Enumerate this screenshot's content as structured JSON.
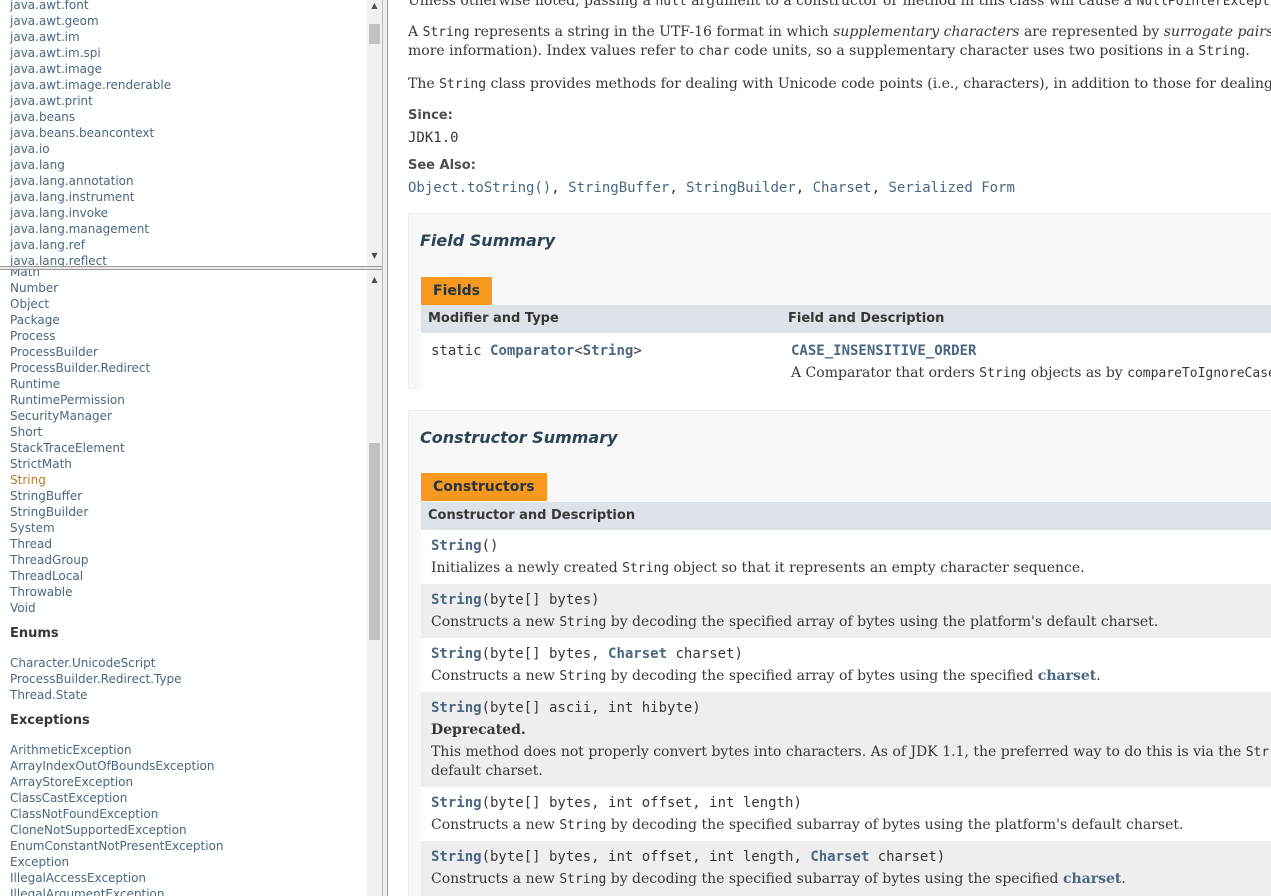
{
  "packages": [
    "java.awt.font",
    "java.awt.geom",
    "java.awt.im",
    "java.awt.im.spi",
    "java.awt.image",
    "java.awt.image.renderable",
    "java.awt.print",
    "java.beans",
    "java.beans.beancontext",
    "java.io",
    "java.lang",
    "java.lang.annotation",
    "java.lang.instrument",
    "java.lang.invoke",
    "java.lang.management",
    "java.lang.ref",
    "java.lang.reflect"
  ],
  "classes_top": [
    "Math",
    "Number",
    "Object",
    "Package",
    "Process",
    "ProcessBuilder",
    "ProcessBuilder.Redirect",
    "Runtime",
    "RuntimePermission",
    "SecurityManager",
    "Short",
    "StackTraceElement",
    "StrictMath"
  ],
  "selected_class": "String",
  "classes_rest": [
    "StringBuffer",
    "StringBuilder",
    "System",
    "Thread",
    "ThreadGroup",
    "ThreadLocal",
    "Throwable",
    "Void"
  ],
  "enums_header": "Enums",
  "enums": [
    "Character.UnicodeScript",
    "ProcessBuilder.Redirect.Type",
    "Thread.State"
  ],
  "exceptions_header": "Exceptions",
  "exceptions": [
    "ArithmeticException",
    "ArrayIndexOutOfBoundsException",
    "ArrayStoreException",
    "ClassCastException",
    "ClassNotFoundException",
    "CloneNotSupportedException",
    "EnumConstantNotPresentException",
    "Exception",
    "IllegalAccessException",
    "IllegalArgumentException"
  ],
  "description": {
    "p0a": "Unless otherwise noted, passing a ",
    "p0b": "null",
    "p0c": " argument to a constructor or method in this class will cause a ",
    "p0d": "NullPointerException",
    "p1a": "A ",
    "p1b": "String",
    "p1c": " represents a string in the UTF-16 format in which ",
    "p1d": "supplementary characters",
    "p1e": " are represented by ",
    "p1f": "surrogate pairs",
    "p2a": "more information). Index values refer to ",
    "p2b": "char",
    "p2c": " code units, so a supplementary character uses two positions in a ",
    "p2d": "String",
    "p2e": ".",
    "p3a": "The ",
    "p3b": "String",
    "p3c": " class provides methods for dealing with Unicode code points (i.e., characters), in addition to those for dealing"
  },
  "since_label": "Since:",
  "since_value": "JDK1.0",
  "see_also_label": "See Also:",
  "see_also": [
    "Object.toString()",
    "StringBuffer",
    "StringBuilder",
    "Charset",
    "Serialized Form"
  ],
  "field_summary": {
    "title": "Field Summary",
    "caption": "Fields",
    "col1": "Modifier and Type",
    "col2": "Field and Description",
    "type_a": "static ",
    "type_b": "Comparator",
    "type_c": "<",
    "type_d": "String",
    "type_e": ">",
    "field_name": "CASE_INSENSITIVE_ORDER",
    "desc_a": "A Comparator that orders ",
    "desc_b": "String",
    "desc_c": " objects as by ",
    "desc_d": "compareToIgnoreCase"
  },
  "constructor_summary": {
    "title": "Constructor Summary",
    "caption": "Constructors",
    "col": "Constructor and Description",
    "c0_name": "String",
    "c0_args": "()",
    "c0_da": "Initializes a newly created ",
    "c0_db": "String",
    "c0_dc": " object so that it represents an empty character sequence.",
    "c1_name": "String",
    "c1_args": "(byte[] bytes)",
    "c1_da": "Constructs a new ",
    "c1_db": "String",
    "c1_dc": " by decoding the specified array of bytes using the platform's default charset.",
    "c2_name": "String",
    "c2_a1": "(byte[] bytes, ",
    "c2_a2": "Charset",
    "c2_a3": " charset)",
    "c2_da": "Constructs a new ",
    "c2_db": "String",
    "c2_dc": " by decoding the specified array of bytes using the specified ",
    "c2_dd": "charset",
    "c2_de": ".",
    "c3_name": "String",
    "c3_args": "(byte[] ascii, int hibyte)",
    "c3_dep": "Deprecated.",
    "c3_da": "This method does not properly convert bytes into characters. As of JDK 1.1, the preferred way to do this is via the ",
    "c3_db": "Str",
    "c3_dc": "default charset.",
    "c4_name": "String",
    "c4_args": "(byte[] bytes, int offset, int length)",
    "c4_da": "Constructs a new ",
    "c4_db": "String",
    "c4_dc": " by decoding the specified subarray of bytes using the platform's default charset.",
    "c5_name": "String",
    "c5_a1": "(byte[] bytes, int offset, int length, ",
    "c5_a2": "Charset",
    "c5_a3": " charset)",
    "c5_da": "Constructs a new ",
    "c5_db": "String",
    "c5_dc": " by decoding the specified subarray of bytes using the specified ",
    "c5_dd": "charset",
    "c5_de": "."
  }
}
